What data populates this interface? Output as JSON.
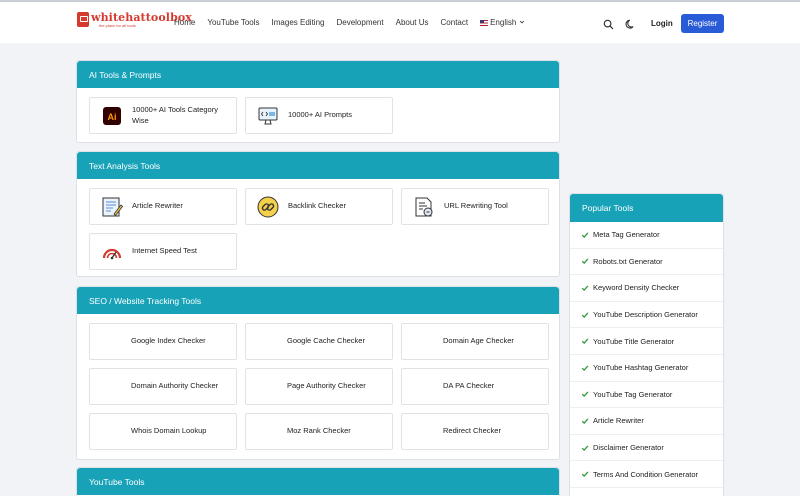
{
  "header": {
    "logo": {
      "name": "whitehattoolbox",
      "tagline": "the place for all tools"
    },
    "nav": [
      "Home",
      "YouTube Tools",
      "Images Editing",
      "Development",
      "About Us",
      "Contact"
    ],
    "language": "English",
    "login_label": "Login",
    "register_label": "Register"
  },
  "sections": [
    {
      "title": "AI Tools & Prompts",
      "items": [
        {
          "label": "10000+ AI Tools Category Wise",
          "icon": "adobe-illustrator-icon"
        },
        {
          "label": "10000+ AI Prompts",
          "icon": "monitor-code-icon"
        }
      ]
    },
    {
      "title": "Text Analysis Tools",
      "items": [
        {
          "label": "Article Rewriter",
          "icon": "document-pencil-icon"
        },
        {
          "label": "Backlink Checker",
          "icon": "link-icon"
        },
        {
          "label": "URL Rewriting Tool",
          "icon": "url-document-icon"
        },
        {
          "label": "Internet Speed Test",
          "icon": "speedometer-icon"
        }
      ]
    },
    {
      "title": "SEO / Website Tracking Tools",
      "items": [
        {
          "label": "Google Index Checker"
        },
        {
          "label": "Google Cache Checker"
        },
        {
          "label": "Domain Age Checker"
        },
        {
          "label": "Domain Authority Checker"
        },
        {
          "label": "Page Authority Checker"
        },
        {
          "label": "DA PA Checker"
        },
        {
          "label": "Whois Domain Lookup"
        },
        {
          "label": "Moz Rank Checker"
        },
        {
          "label": "Redirect Checker"
        }
      ]
    },
    {
      "title": "YouTube Tools",
      "items": []
    }
  ],
  "popular": {
    "title": "Popular Tools",
    "items": [
      "Meta Tag Generator",
      "Robots.txt Generator",
      "Keyword Density Checker",
      "YouTube Description Generator",
      "YouTube Title Generator",
      "YouTube Hashtag Generator",
      "YouTube Tag Generator",
      "Article Rewriter",
      "Disclaimer Generator",
      "Terms And Condition Generator"
    ]
  },
  "colors": {
    "section_header": "#17a2b8",
    "register_button": "#2a5bd7",
    "check": "#2e9a3a",
    "logo": "#d63a2f"
  }
}
